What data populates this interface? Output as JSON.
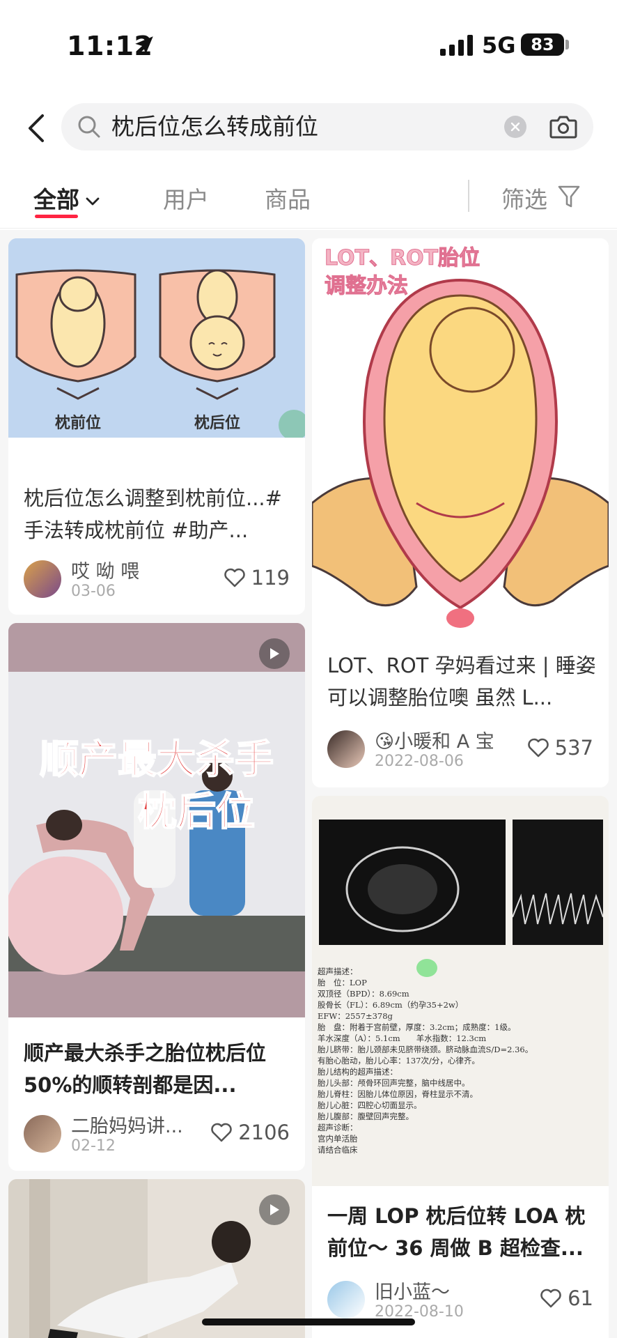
{
  "status_bar": {
    "time": "11:12",
    "network": "5G",
    "battery": "83"
  },
  "search": {
    "query": "枕后位怎么转成前位"
  },
  "tabs": [
    {
      "label": "全部"
    },
    {
      "label": "用户"
    },
    {
      "label": "商品"
    }
  ],
  "filter_label": "筛选",
  "feed": {
    "left": [
      {
        "image_labels": [
          "枕前位",
          "枕后位"
        ],
        "title": "枕后位怎么调整到枕前位...#手法转成枕前位 #助产...",
        "author": "哎 呦 喂",
        "date": "03-06",
        "likes": "119"
      },
      {
        "image_text": [
          "顺产最大杀手",
          "枕后位"
        ],
        "title": "顺产最大杀手之胎位枕后位 50%的顺转剖都是因...",
        "author": "二胎妈妈讲...",
        "date": "02-12",
        "likes": "2106"
      }
    ],
    "right": [
      {
        "image_text": [
          "LOT、ROT胎位",
          "调整办法"
        ],
        "title": "LOT、ROT 孕妈看过来 | 睡姿可以调整胎位噢 虽然 L...",
        "author": "😘小暖和 A 宝",
        "date": "2022-08-06",
        "likes": "537"
      },
      {
        "report_lines": [
          "超声描述：",
          "胎　位：LOP",
          "双顶径（BPD）：8.69cm",
          "股骨长（FL）：6.89cm（约孕35+2w）",
          "EFW：2557±378g",
          "胎　盘：附着于宫前壁，厚度：3.2cm；成熟度：1级。",
          "羊水深度（A）：5.1cm　　羊水指数：12.3cm",
          "胎儿脐带：胎儿颈部未见脐带绕颈。脐动脉血流S/D=2.36。",
          "有胎心胎动，胎儿心率：137次/分，心律齐。",
          "胎儿结构的超声描述：",
          "胎儿头部：颅骨环回声完整，脑中线居中。",
          "胎儿脊柱：因胎儿体位原因，脊柱显示不清。",
          "胎儿心脏：四腔心切面显示。",
          "胎儿腹部：腹壁回声完整。",
          "超声诊断：",
          "宫内单活胎",
          "请结合临床"
        ],
        "title": "一周 LOP 枕后位转 LOA 枕前位～ 36 周做 B 超检查...",
        "author": "旧小蓝～",
        "date": "2022-08-10",
        "likes": "61"
      }
    ]
  }
}
